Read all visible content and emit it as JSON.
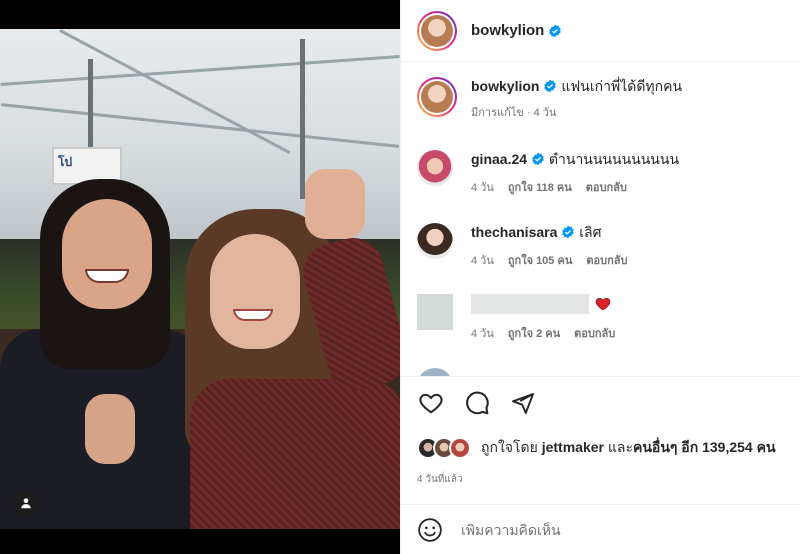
{
  "post_author": {
    "username": "bowkylion",
    "verified": true
  },
  "caption": {
    "username": "bowkylion",
    "text": "แฟนเก่าพี่ได้ดีทุกคน",
    "meta": "มีการแก้ไข · 4 วัน"
  },
  "comments": [
    {
      "username": "ginaa.24",
      "verified": true,
      "text": "ตำนานนนนนนนนนน",
      "time": "4 วัน",
      "likes": "ถูกใจ 118 คน",
      "reply": "ตอบกลับ"
    },
    {
      "username": "thechanisara",
      "verified": true,
      "text": "เลิศ",
      "time": "4 วัน",
      "likes": "ถูกใจ 105 คน",
      "reply": "ตอบกลับ"
    },
    {
      "username": "",
      "verified": false,
      "text": "",
      "time": "4 วัน",
      "likes": "ถูกใจ 2 คน",
      "reply": "ตอบกลับ"
    }
  ],
  "photo_sign_text": "โป",
  "likes": {
    "prefix": "ถูกใจโดย ",
    "user": "jettmaker",
    "middle": " และ",
    "others": "คนอื่นๆ อีก 139,254 คน"
  },
  "posted_time": "4 วันที่แล้ว",
  "add_comment": {
    "placeholder": "เพิ่มความคิดเห็น"
  },
  "icons": {
    "verified": "verified-badge-icon",
    "like": "heart-icon",
    "comment": "comment-icon",
    "share": "send-icon",
    "emoji": "emoji-icon",
    "tag": "tagged-user-icon"
  },
  "colors": {
    "verified": "#0095f6",
    "heart_red": "#ed4956",
    "muted": "#737373"
  }
}
